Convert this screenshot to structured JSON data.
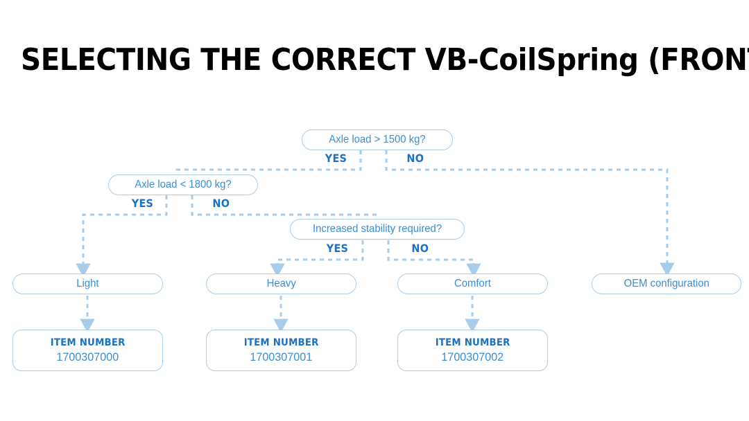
{
  "page": {
    "title": "SELECTING THE CORRECT VB-CoilSpring (FRONT AXLE)"
  },
  "colors": {
    "border": "#a8cdea",
    "node_text": "#3a8ed2",
    "branch_text": "#1a72c0",
    "connector": "#a8cdea",
    "title_text": "#000000",
    "background": "#ffffff"
  },
  "decisions": [
    {
      "id": "axle-load-1500",
      "question": "Axle load > 1500 kg?",
      "yes_label": "YES",
      "no_label": "NO"
    },
    {
      "id": "axle-load-1800",
      "question": "Axle load < 1800 kg?",
      "yes_label": "YES",
      "no_label": "NO"
    },
    {
      "id": "increased-stability",
      "question": "Increased stability required?",
      "yes_label": "YES",
      "no_label": "NO"
    }
  ],
  "outcomes": [
    {
      "id": "light",
      "label": "Light"
    },
    {
      "id": "heavy",
      "label": "Heavy"
    },
    {
      "id": "comfort",
      "label": "Comfort"
    },
    {
      "id": "oem",
      "label": "OEM configuration"
    }
  ],
  "item_boxes": [
    {
      "id": "item-light",
      "heading": "ITEM NUMBER",
      "number": "1700307000"
    },
    {
      "id": "item-heavy",
      "heading": "ITEM NUMBER",
      "number": "1700307001"
    },
    {
      "id": "item-comfort",
      "heading": "ITEM NUMBER",
      "number": "1700307002"
    }
  ]
}
